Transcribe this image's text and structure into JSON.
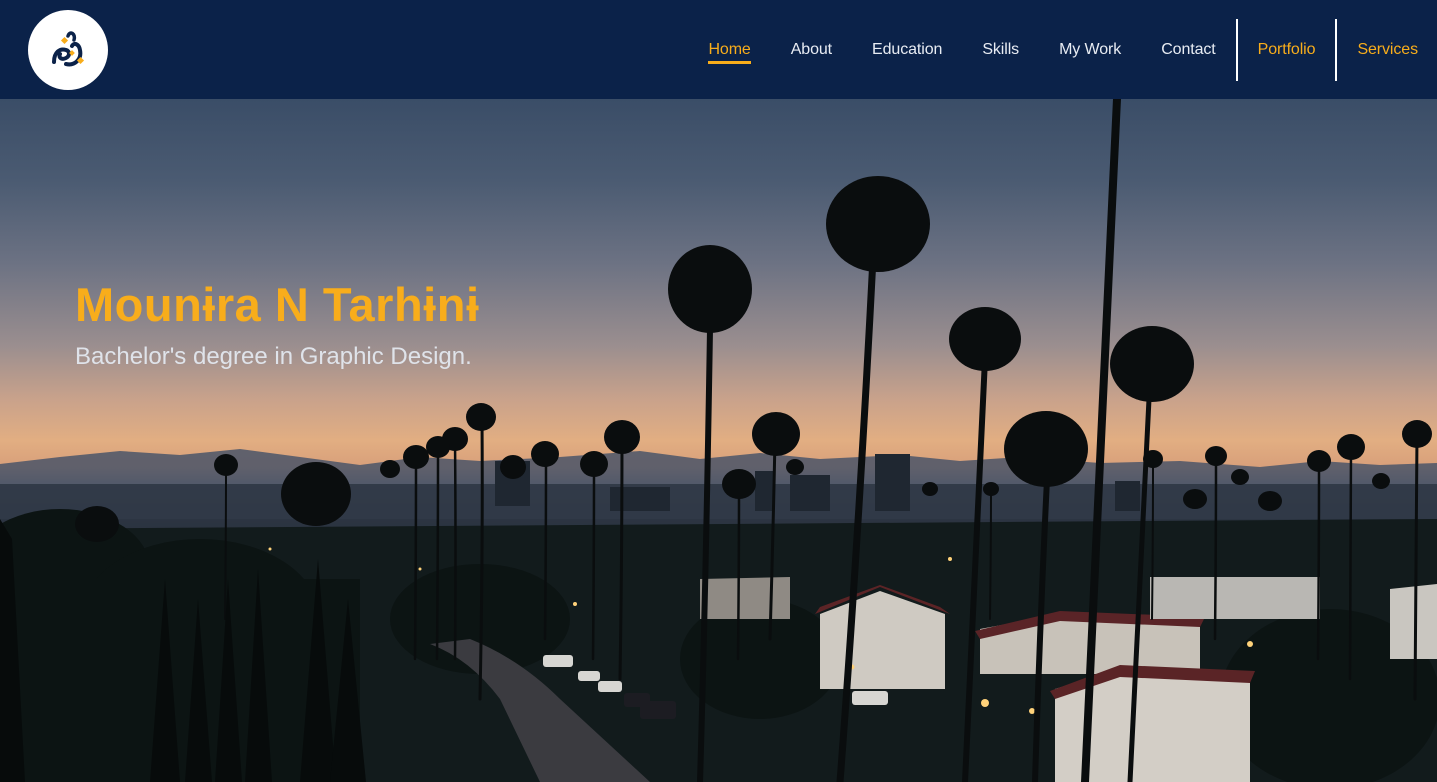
{
  "header": {
    "logo_alt": "logo",
    "nav": [
      {
        "label": "Home"
      },
      {
        "label": "About"
      },
      {
        "label": "Education"
      },
      {
        "label": "Skills"
      },
      {
        "label": "My Work"
      },
      {
        "label": "Contact"
      },
      {
        "label": "Portfolio"
      },
      {
        "label": "Services"
      }
    ],
    "active_item": "Home"
  },
  "hero": {
    "title": "Mounɨra N Tarhɨnɨ",
    "subtitle": "Bachelor's degree in Graphic Design."
  },
  "colors": {
    "navbar": "#0b2249",
    "accent": "#f8ad1b",
    "nav_text": "#e8ecf3"
  }
}
